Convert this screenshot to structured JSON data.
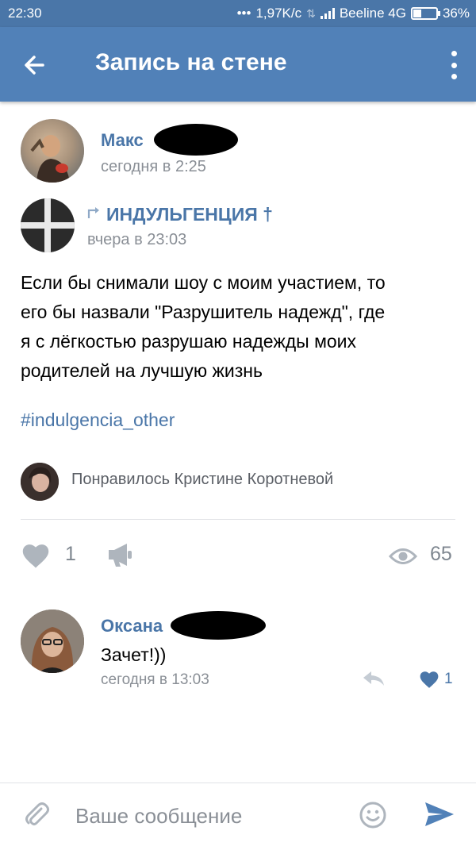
{
  "status_bar": {
    "time": "22:30",
    "net_speed": "1,97K/c",
    "carrier": "Beeline 4G",
    "battery": "36%",
    "battery_level": 0.36
  },
  "header": {
    "title": "Запись на стене"
  },
  "repost_author": {
    "name": "Макс",
    "time": "сегодня в 2:25"
  },
  "source": {
    "name": "ИНДУЛЬГЕНЦИЯ †",
    "time": "вчера в 23:03"
  },
  "post": {
    "lines": [
      "Если бы снимали шоу с моим участием, то",
      "его бы назвали \"Разрушитель надежд\", где",
      "я с лёгкостью разрушаю надежды моих",
      "родителей на лучшую жизнь"
    ],
    "hashtag": "#indulgencia_other"
  },
  "liked_by": {
    "text": "Понравилось Кристине Коротневой"
  },
  "actions": {
    "likes": "1",
    "views": "65"
  },
  "comment": {
    "author": "Оксана",
    "text": "Зачет!))",
    "time": "сегодня в 13:03",
    "likes": "1"
  },
  "composer": {
    "placeholder": "Ваше сообщение"
  },
  "colors": {
    "header": "#5181b8",
    "status": "#4a76a8",
    "link": "#4a76a8",
    "like_accent": "#4a76a8",
    "muted": "#8a8f96"
  }
}
